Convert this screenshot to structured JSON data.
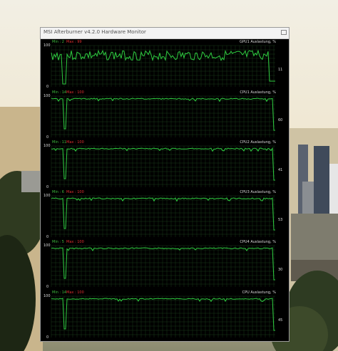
{
  "window": {
    "title": "MSI Afterburner v4.2.0 Hardware Monitor"
  },
  "graphs": [
    {
      "label": "GPU1 Auslastung, %",
      "min_label": "Min : 2",
      "max_label": "Max : 99",
      "y_max": "100",
      "y_min": "0",
      "current": "11"
    },
    {
      "label": "CPU1 Auslastung, %",
      "min_label": "Min : 14",
      "max_label": "Max : 100",
      "y_max": "100",
      "y_min": "0",
      "current": "60"
    },
    {
      "label": "CPU2 Auslastung, %",
      "min_label": "Min : 11",
      "max_label": "Max : 100",
      "y_max": "100",
      "y_min": "0",
      "current": "41"
    },
    {
      "label": "CPU3 Auslastung, %",
      "min_label": "Min : 6",
      "max_label": "Max : 100",
      "y_max": "100",
      "y_min": "0",
      "current": "53"
    },
    {
      "label": "CPU4 Auslastung, %",
      "min_label": "Min : 5",
      "max_label": "Max : 100",
      "y_max": "100",
      "y_min": "0",
      "current": "30"
    },
    {
      "label": "CPU Auslastung, %",
      "min_label": "Min : 14",
      "max_label": "Max : 100",
      "y_max": "100",
      "y_min": "0",
      "current": "45"
    }
  ],
  "colors": {
    "trace": "#2ecc40",
    "grid": "#1a3a1a",
    "min_text": "#3fbf3f",
    "max_text": "#e03030",
    "window_bg": "#000000"
  }
}
